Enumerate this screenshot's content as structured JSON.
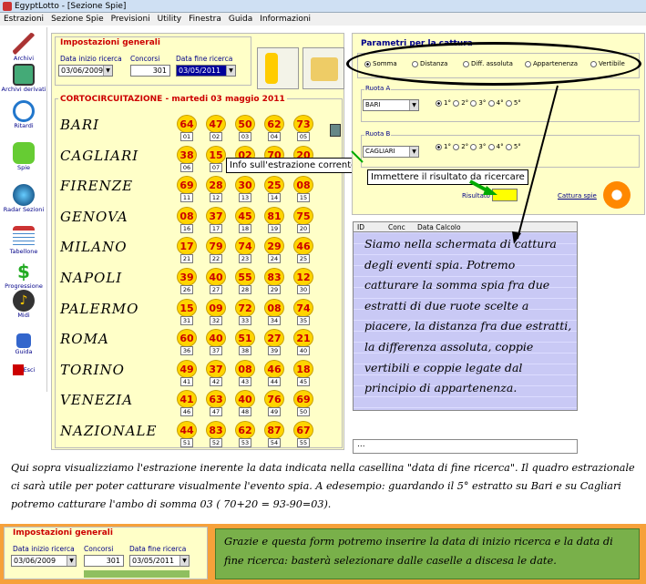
{
  "window": {
    "title": "EgyptLotto - [Sezione Spie]"
  },
  "menu": [
    "Estrazioni",
    "Sezione Spie",
    "Previsioni",
    "Utility",
    "Finestra",
    "Guida",
    "Informazioni"
  ],
  "sidebar": [
    "Archivi",
    "Archivi derivati",
    "Ritardi",
    "Spie",
    "Radar Sezioni",
    "Tabellone",
    "Progressione",
    "Midi",
    "Guida",
    "Esci"
  ],
  "impostazioni": {
    "title": "Impostazioni generali",
    "label_inizio": "Data inizio ricerca",
    "label_concorsi": "Concorsi",
    "label_fine": "Data fine ricerca",
    "inizio": "03/06/2009",
    "concorsi": "301",
    "fine": "03/05/2011"
  },
  "corto": {
    "title": "CORTOCIRCUITAZIONE - martedi 03 maggio 2011"
  },
  "ruote": [
    {
      "name": "BARI",
      "nums": [
        "64",
        "47",
        "50",
        "62",
        "73"
      ],
      "subs": [
        "01",
        "02",
        "03",
        "04",
        "05"
      ]
    },
    {
      "name": "CAGLIARI",
      "nums": [
        "38",
        "15",
        "02",
        "70",
        "20"
      ],
      "subs": [
        "06",
        "07",
        "08",
        "09",
        "10"
      ]
    },
    {
      "name": "FIRENZE",
      "nums": [
        "69",
        "28",
        "30",
        "25",
        "08"
      ],
      "subs": [
        "11",
        "12",
        "13",
        "14",
        "15"
      ]
    },
    {
      "name": "GENOVA",
      "nums": [
        "08",
        "37",
        "45",
        "81",
        "75"
      ],
      "subs": [
        "16",
        "17",
        "18",
        "19",
        "20"
      ]
    },
    {
      "name": "MILANO",
      "nums": [
        "17",
        "79",
        "74",
        "29",
        "46"
      ],
      "subs": [
        "21",
        "22",
        "23",
        "24",
        "25"
      ]
    },
    {
      "name": "NAPOLI",
      "nums": [
        "39",
        "40",
        "55",
        "83",
        "12"
      ],
      "subs": [
        "26",
        "27",
        "28",
        "29",
        "30"
      ]
    },
    {
      "name": "PALERMO",
      "nums": [
        "15",
        "09",
        "72",
        "08",
        "74"
      ],
      "subs": [
        "31",
        "32",
        "33",
        "34",
        "35"
      ]
    },
    {
      "name": "ROMA",
      "nums": [
        "60",
        "40",
        "51",
        "27",
        "21"
      ],
      "subs": [
        "36",
        "37",
        "38",
        "39",
        "40"
      ]
    },
    {
      "name": "TORINO",
      "nums": [
        "49",
        "37",
        "08",
        "46",
        "18"
      ],
      "subs": [
        "41",
        "42",
        "43",
        "44",
        "45"
      ]
    },
    {
      "name": "VENEZIA",
      "nums": [
        "41",
        "63",
        "40",
        "76",
        "69"
      ],
      "subs": [
        "46",
        "47",
        "48",
        "49",
        "50"
      ]
    },
    {
      "name": "NAZIONALE",
      "nums": [
        "44",
        "83",
        "62",
        "87",
        "67"
      ],
      "subs": [
        "51",
        "52",
        "53",
        "54",
        "55"
      ]
    }
  ],
  "tooltips": {
    "info": "Info sull'estrazione corrente",
    "risultato": "Immettere il risultato da ricercare"
  },
  "cattura": {
    "title": "Parametri per la cattura",
    "options": [
      "Somma",
      "Distanza",
      "Diff. assoluta",
      "Appartenenza",
      "Vertibile"
    ],
    "ruotaA": "Ruota A",
    "ruotaA_val": "BARI",
    "ruotaB": "Ruota B",
    "ruotaB_val": "CAGLIARI",
    "pos": [
      "1°",
      "2°",
      "3°",
      "4°",
      "5°"
    ],
    "risultato": "Risultato",
    "link": "Cattura spie"
  },
  "table": {
    "cols": [
      "ID",
      "Conc",
      "Data Calcolo"
    ],
    "footer": "..."
  },
  "note1": "Siamo nella schermata di cattura degli eventi spia. Potremo catturare la somma spia fra due estratti di due ruote scelte a piacere, la distanza fra due estratti, la differenza assoluta, coppie vertibili e coppie legate dal principio di appartenenza.",
  "note2": "Qui sopra visualizziamo l'estrazione inerente la data indicata nella casellina \"data di fine ricerca\". Il quadro estrazionale ci sarà utile per poter catturare visualmente l'evento spia. A edesempio: guardando il 5° estratto su Bari e su Cagliari potremo catturare l'ambo di somma 03 ( 70+20 = 93-90=03).",
  "note3": "Grazie e questa form potremo inserire la data di inizio ricerca e la data di fine ricerca: basterà selezionare dalle caselle a discesa le date."
}
